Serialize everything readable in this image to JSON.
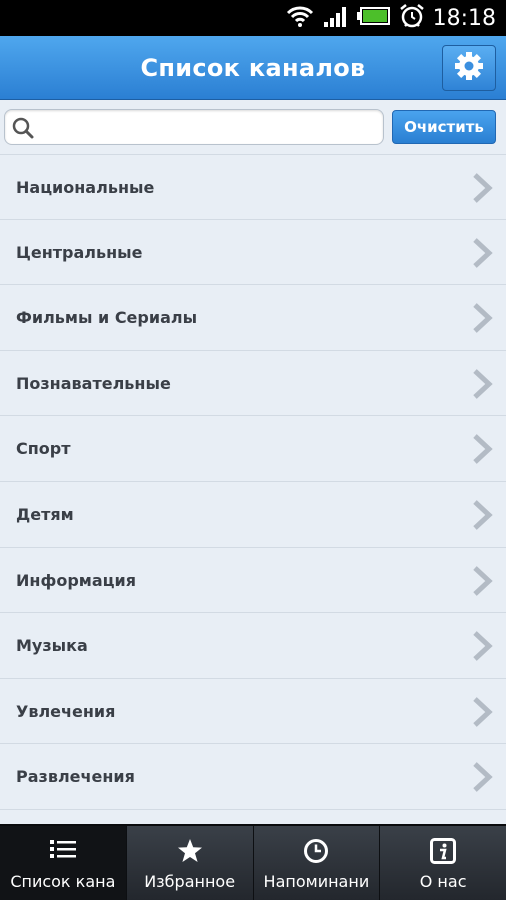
{
  "status_bar": {
    "time": "18:18"
  },
  "header": {
    "title": "Список каналов"
  },
  "search": {
    "placeholder": "",
    "value": "",
    "clear_label": "Очистить"
  },
  "categories": [
    {
      "label": "Национальные"
    },
    {
      "label": "Центральные"
    },
    {
      "label": "Фильмы и Сериалы"
    },
    {
      "label": "Познавательные"
    },
    {
      "label": "Спорт"
    },
    {
      "label": "Детям"
    },
    {
      "label": "Информация"
    },
    {
      "label": "Музыка"
    },
    {
      "label": "Увлечения"
    },
    {
      "label": "Развлечения"
    }
  ],
  "tabs": [
    {
      "label": "Список кана",
      "icon": "list-icon",
      "active": true
    },
    {
      "label": "Избранное",
      "icon": "star-icon",
      "active": false
    },
    {
      "label": "Напоминани",
      "icon": "clock-icon",
      "active": false
    },
    {
      "label": "О нас",
      "icon": "info-icon",
      "active": false
    }
  ],
  "colors": {
    "header_blue": "#2b7fd3",
    "button_blue": "#2a7fd2",
    "list_bg": "#e8eef5",
    "tab_bg": "#23272d"
  }
}
